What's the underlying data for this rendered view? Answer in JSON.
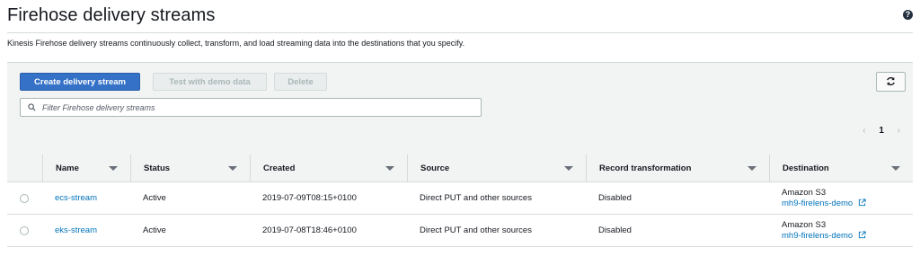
{
  "header": {
    "title": "Firehose delivery streams",
    "help_icon": "?"
  },
  "description": "Kinesis Firehose delivery streams continuously collect, transform, and load streaming data into the destinations that you specify.",
  "toolbar": {
    "create_label": "Create delivery stream",
    "test_label": "Test with demo data",
    "delete_label": "Delete",
    "refresh_icon": "refresh-icon"
  },
  "filter": {
    "placeholder": "Filter Firehose delivery streams",
    "value": ""
  },
  "pagination": {
    "prev": "‹",
    "page": "1",
    "next": "›"
  },
  "table": {
    "columns": [
      "Name",
      "Status",
      "Created",
      "Source",
      "Record transformation",
      "Destination"
    ],
    "rows": [
      {
        "name": "ecs-stream",
        "status": "Active",
        "created": "2019-07-09T08:15+0100",
        "source": "Direct PUT and other sources",
        "transformation": "Disabled",
        "destination_type": "Amazon S3",
        "destination_link": "mh9-firelens-demo"
      },
      {
        "name": "eks-stream",
        "status": "Active",
        "created": "2019-07-08T18:46+0100",
        "source": "Direct PUT and other sources",
        "transformation": "Disabled",
        "destination_type": "Amazon S3",
        "destination_link": "mh9-firelens-demo"
      }
    ]
  },
  "colors": {
    "primary": "#3471c7",
    "link": "#0073bb",
    "panel": "#f2f3f3",
    "border": "#d5dbdb"
  }
}
